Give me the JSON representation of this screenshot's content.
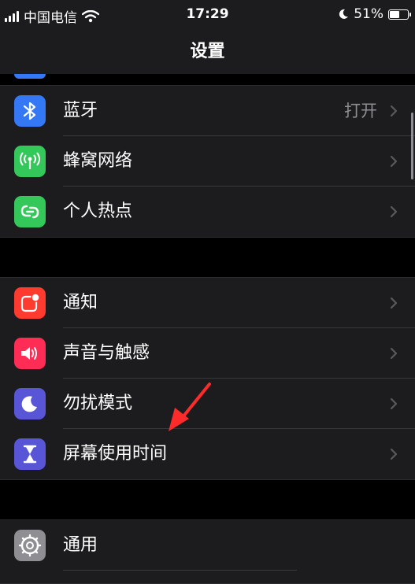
{
  "status": {
    "carrier": "中国电信",
    "time": "17:29",
    "battery_text": "51%",
    "battery_level": 0.51,
    "icons": [
      "signal-icon",
      "wifi-icon",
      "moon-icon",
      "battery-icon"
    ]
  },
  "nav": {
    "title": "设置"
  },
  "groups": [
    {
      "items": [
        {
          "label": "蓝牙",
          "value": "打开",
          "icon": "bluetooth-icon",
          "color": "#3478f6"
        },
        {
          "label": "蜂窝网络",
          "icon": "antenna-icon",
          "color": "#34c759"
        },
        {
          "label": "个人热点",
          "icon": "hotspot-icon",
          "color": "#34c759"
        }
      ]
    },
    {
      "items": [
        {
          "label": "通知",
          "icon": "notification-icon",
          "color": "#ff3b30"
        },
        {
          "label": "声音与触感",
          "icon": "speaker-icon",
          "color": "#ff2d55"
        },
        {
          "label": "勿扰模式",
          "icon": "moon-icon",
          "color": "#5856d6"
        },
        {
          "label": "屏幕使用时间",
          "icon": "hourglass-icon",
          "color": "#5856d6"
        }
      ]
    },
    {
      "items": [
        {
          "label": "通用",
          "icon": "gear-icon",
          "color": "#8e8e93"
        }
      ]
    }
  ],
  "annotation": {
    "arrow_color": "#ff2a2a"
  }
}
